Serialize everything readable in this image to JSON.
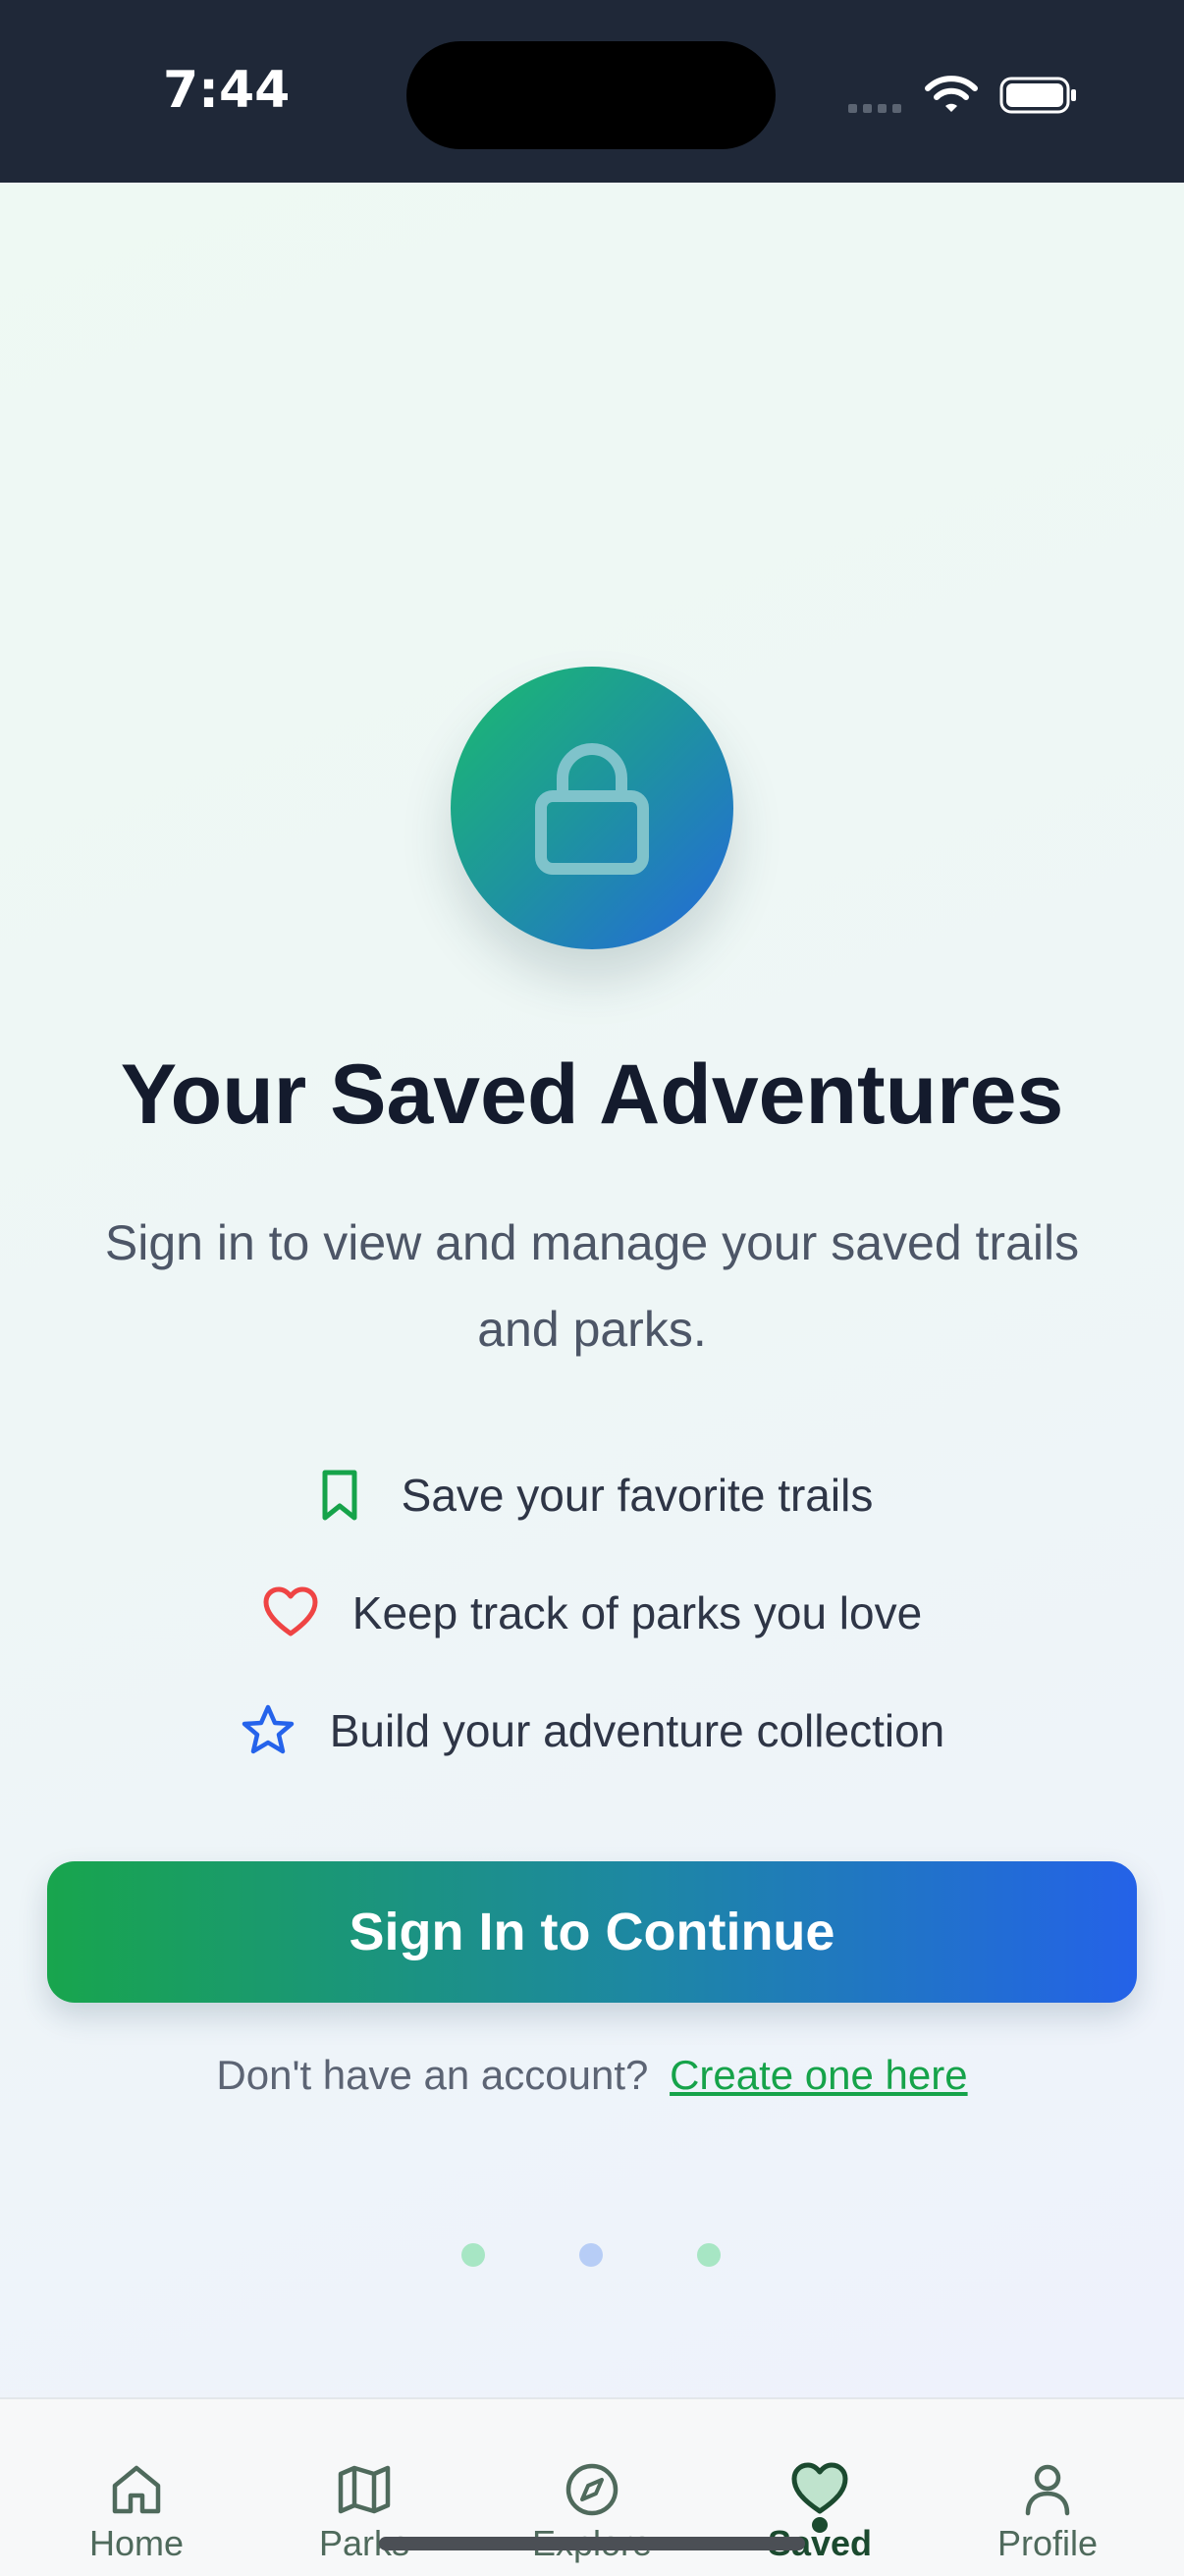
{
  "status_bar": {
    "time": "7:44"
  },
  "hero": {
    "icon": "lock-icon",
    "title": "Your Saved Adventures",
    "subtitle": "Sign in to view and manage your saved trails and parks."
  },
  "features": [
    {
      "icon": "bookmark-icon",
      "color": "#16a34a",
      "text": "Save your favorite trails"
    },
    {
      "icon": "heart-icon",
      "color": "#ef4444",
      "text": "Keep track of parks you love"
    },
    {
      "icon": "star-icon",
      "color": "#2563eb",
      "text": "Build your adventure collection"
    }
  ],
  "cta": {
    "label": "Sign In to Continue"
  },
  "signup": {
    "prompt": "Don't have an account?",
    "link": "Create one here"
  },
  "pagination": {
    "count": 3
  },
  "tab_bar": {
    "active": "Saved",
    "items": [
      {
        "label": "Home",
        "icon": "home-icon"
      },
      {
        "label": "Parks",
        "icon": "map-icon"
      },
      {
        "label": "Explore",
        "icon": "compass-icon"
      },
      {
        "label": "Saved",
        "icon": "heart-icon"
      },
      {
        "label": "Profile",
        "icon": "user-icon"
      }
    ]
  },
  "colors": {
    "brand_green": "#16a34a",
    "brand_blue": "#2563eb",
    "title_text": "#141b2d",
    "tab_active": "#1b4a2f"
  }
}
